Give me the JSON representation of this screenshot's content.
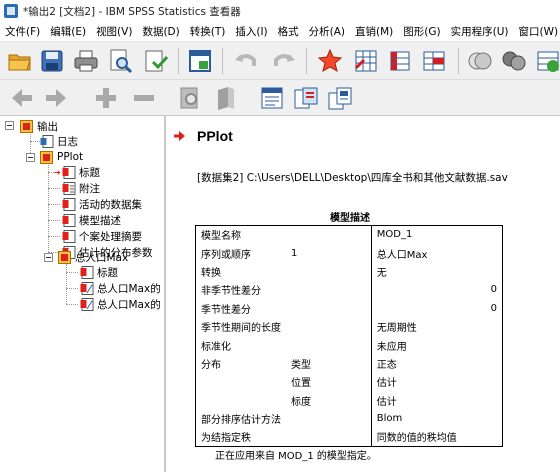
{
  "window": {
    "title": "*输出2 [文档2] - IBM SPSS Statistics 查看器"
  },
  "menubar": {
    "items": [
      "文件(F)",
      "编辑(E)",
      "视图(V)",
      "数据(D)",
      "转换(T)",
      "插入(I)",
      "格式",
      "分析(A)",
      "直销(M)",
      "图形(G)",
      "实用程序(U)",
      "窗口(W)"
    ]
  },
  "toolbar": {
    "row1_icons": [
      "open-folder-icon",
      "save-icon",
      "print-icon",
      "print-preview-icon",
      "export-icon",
      "recall-dialog-icon",
      "undo-icon",
      "redo-icon",
      "goto-data-icon",
      "goto-case-icon",
      "goto-variable-icon",
      "variables-icon",
      "split-icon",
      "weight-icon"
    ],
    "row2_icons": [
      "back-icon",
      "forward-icon",
      "expand-icon",
      "collapse-icon",
      "show-icon",
      "hide-icon",
      "insert-heading-icon",
      "insert-title-icon",
      "insert-text-icon"
    ]
  },
  "tree": {
    "root": "输出",
    "items": [
      {
        "label": "日志"
      },
      {
        "label": "PPlot"
      },
      {
        "label": "标题"
      },
      {
        "label": "附注"
      },
      {
        "label": "活动的数据集"
      },
      {
        "label": "模型描述"
      },
      {
        "label": "个案处理摘要"
      },
      {
        "label": "估计的分布参数"
      },
      {
        "label": "总人口Max"
      },
      {
        "label": "标题"
      },
      {
        "label": "总人口Max的"
      },
      {
        "label": "总人口Max的"
      }
    ]
  },
  "output": {
    "heading": "PPlot",
    "dataset_line": "[数据集2] C:\\Users\\DELL\\Desktop\\四库全书和其他文献数据.sav",
    "table_title": "模型描述",
    "rows": [
      {
        "c1": "模型名称",
        "c2": "",
        "c3": "MOD_1"
      },
      {
        "c1": "序列或顺序",
        "c2": "1",
        "c3": "总人口Max"
      },
      {
        "c1": "转换",
        "c2": "",
        "c3": "无"
      },
      {
        "c1": "非季节性差分",
        "c2": "",
        "c3": "0"
      },
      {
        "c1": "季节性差分",
        "c2": "",
        "c3": "0"
      },
      {
        "c1": "季节性期间的长度",
        "c2": "",
        "c3": "无周期性"
      },
      {
        "c1": "标准化",
        "c2": "",
        "c3": "未应用"
      },
      {
        "c1": "分布",
        "c2": "类型",
        "c3": "正态"
      },
      {
        "c1": "",
        "c2": "位置",
        "c3": "估计"
      },
      {
        "c1": "",
        "c2": "标度",
        "c3": "估计"
      },
      {
        "c1": "部分排序估计方法",
        "c2": "",
        "c3": "Blom"
      },
      {
        "c1": "为结指定秩",
        "c2": "",
        "c3": "同数的值的秩均值"
      }
    ],
    "footnote": "正在应用来自 MOD_1 的模型指定。"
  },
  "colors": {
    "accent_red": "#e0201b",
    "pane_divider": "#c8c8c8",
    "toolbar_bg": "#f0f0f0"
  }
}
